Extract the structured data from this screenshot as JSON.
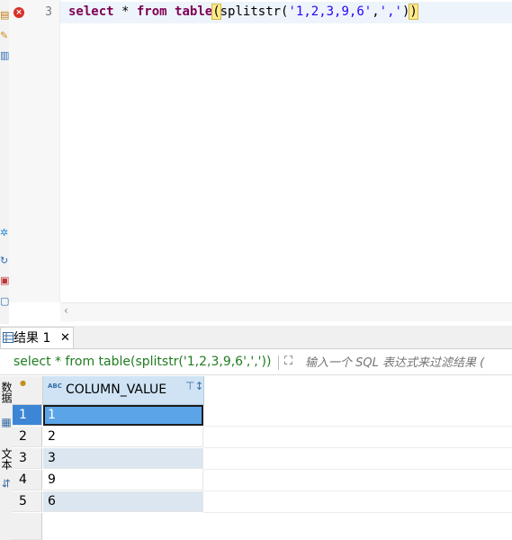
{
  "left_toolbar": {
    "icons": [
      "database-icon",
      "sql-editor-icon",
      "script-icon",
      "gear-icon",
      "refresh-icon",
      "lock-icon",
      "document-icon"
    ]
  },
  "editor": {
    "line_number": "3",
    "code": {
      "kw_select": "select",
      "star": " * ",
      "kw_from": "from",
      "space": " ",
      "kw_table": "table",
      "open_paren": "(",
      "fn": "splitstr(",
      "arg1": "'1,2,3,9,6'",
      "comma": ",",
      "arg2": "','",
      "close_inner": ")",
      "close_paren": ")"
    },
    "scroll_arrow": "‹"
  },
  "results": {
    "tab_label": "结果 1",
    "tab_close": "✕",
    "query_text": "select * from table(splitstr('1,2,3,9,6',','))",
    "filter_placeholder": "输入一个 SQL 表达式来过滤结果 (",
    "side_labels": [
      "数据",
      "文本"
    ],
    "column_header": "COLUMN_VALUE",
    "column_type": "ABC",
    "rows": [
      {
        "num": "1",
        "value": "1"
      },
      {
        "num": "2",
        "value": "2"
      },
      {
        "num": "3",
        "value": "3"
      },
      {
        "num": "4",
        "value": "9"
      },
      {
        "num": "5",
        "value": "6"
      }
    ]
  }
}
